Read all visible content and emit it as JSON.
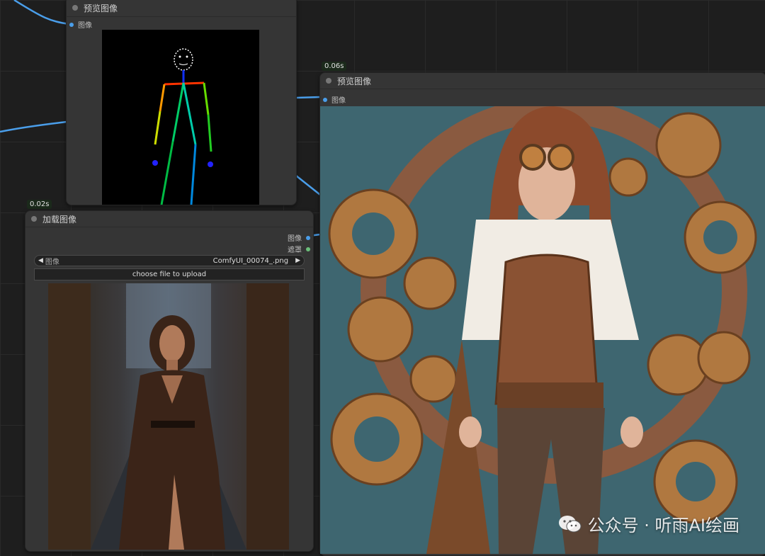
{
  "nodes": {
    "preview_top": {
      "title": "预览图像",
      "input_label": "图像"
    },
    "preview_right": {
      "title": "预览图像",
      "input_label": "图像",
      "timing": "0.06s"
    },
    "load_image": {
      "title": "加载图像",
      "timing": "0.02s",
      "outputs": [
        "图像",
        "遮罩"
      ],
      "image_widget": {
        "label": "图像",
        "value": "ComfyUI_00074_.png"
      },
      "upload_button": "choose file to upload"
    }
  },
  "watermark": {
    "text": "公众号 · 听雨AI绘画"
  },
  "colors": {
    "image_link": "#4a9eea",
    "mask_link": "#6bbf7a"
  }
}
